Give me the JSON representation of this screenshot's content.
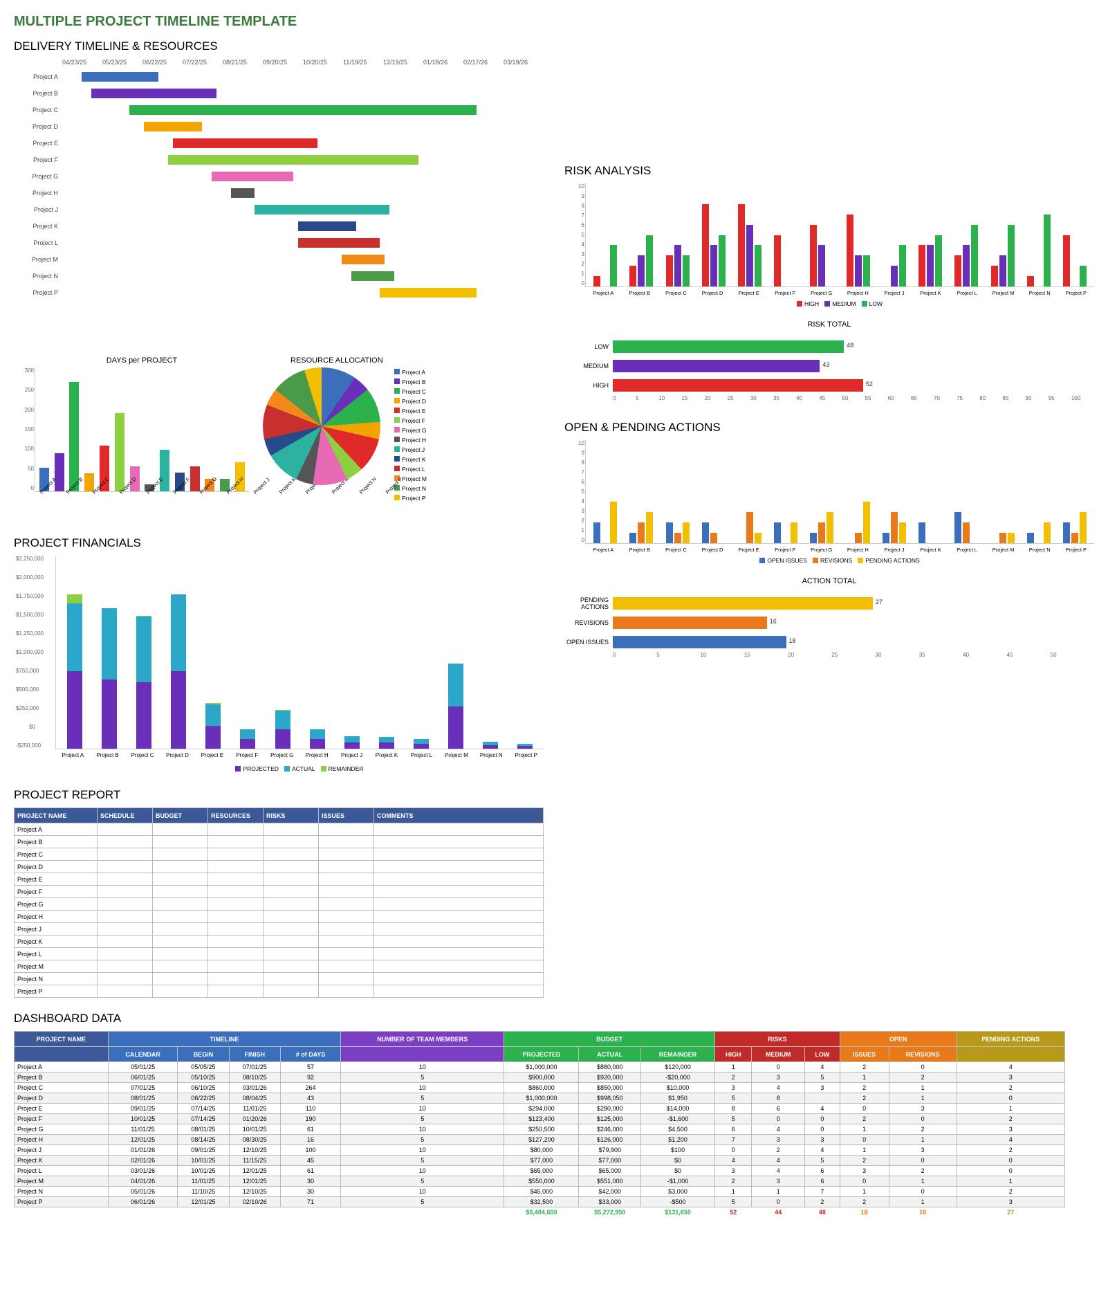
{
  "titles": {
    "main": "MULTIPLE PROJECT TIMELINE TEMPLATE",
    "delivery": "DELIVERY TIMELINE & RESOURCES",
    "risk": "RISK ANALYSIS",
    "risk_total": "RISK TOTAL",
    "actions": "OPEN & PENDING ACTIONS",
    "action_total": "ACTION TOTAL",
    "days_per_project": "DAYS per PROJECT",
    "resource_alloc": "RESOURCE ALLOCATION",
    "financials": "PROJECT FINANCIALS",
    "report": "PROJECT REPORT",
    "dashboard": "DASHBOARD DATA"
  },
  "projects": [
    "Project A",
    "Project B",
    "Project C",
    "Project D",
    "Project E",
    "Project F",
    "Project G",
    "Project H",
    "Project J",
    "Project K",
    "Project L",
    "Project M",
    "Project N",
    "Project P"
  ],
  "colors": {
    "Project A": "#3b6fbb",
    "Project B": "#6a2fb8",
    "Project C": "#2bb24c",
    "Project D": "#f2a500",
    "Project E": "#e02a2a",
    "Project F": "#8ecf42",
    "Project G": "#e86ab5",
    "Project H": "#555555",
    "Project J": "#2bb2a0",
    "Project K": "#284a8a",
    "Project L": "#c83030",
    "Project M": "#f28a1a",
    "Project N": "#4a9a4a",
    "Project P": "#f2c000"
  },
  "risk_colors": {
    "HIGH": "#e02a2a",
    "MEDIUM": "#6a2fb8",
    "LOW": "#2bb24c"
  },
  "action_colors": {
    "OPEN ISSUES": "#3b6fbb",
    "REVISIONS": "#e87a1a",
    "PENDING ACTIONS": "#f2c000"
  },
  "chart_data": [
    {
      "type": "gantt",
      "title": "DELIVERY TIMELINE & RESOURCES",
      "x_ticks": [
        "04/23/25",
        "05/23/25",
        "06/22/25",
        "07/22/25",
        "08/21/25",
        "09/20/25",
        "10/20/25",
        "11/19/25",
        "12/19/25",
        "01/18/26",
        "02/17/26",
        "03/19/26"
      ],
      "bars": [
        {
          "name": "Project A",
          "start_pct": 4,
          "width_pct": 16
        },
        {
          "name": "Project B",
          "start_pct": 6,
          "width_pct": 26
        },
        {
          "name": "Project C",
          "start_pct": 14,
          "width_pct": 72
        },
        {
          "name": "Project D",
          "start_pct": 17,
          "width_pct": 12
        },
        {
          "name": "Project E",
          "start_pct": 23,
          "width_pct": 30
        },
        {
          "name": "Project F",
          "start_pct": 22,
          "width_pct": 52
        },
        {
          "name": "Project G",
          "start_pct": 31,
          "width_pct": 17
        },
        {
          "name": "Project H",
          "start_pct": 35,
          "width_pct": 5
        },
        {
          "name": "Project J",
          "start_pct": 40,
          "width_pct": 28
        },
        {
          "name": "Project K",
          "start_pct": 49,
          "width_pct": 12
        },
        {
          "name": "Project L",
          "start_pct": 49,
          "width_pct": 17
        },
        {
          "name": "Project M",
          "start_pct": 58,
          "width_pct": 9
        },
        {
          "name": "Project N",
          "start_pct": 60,
          "width_pct": 9
        },
        {
          "name": "Project P",
          "start_pct": 66,
          "width_pct": 20
        }
      ]
    },
    {
      "type": "bar",
      "title": "DAYS per PROJECT",
      "categories": [
        "Project A",
        "Project B",
        "Project C",
        "Project D",
        "Project E",
        "Project F",
        "Project G",
        "Project H",
        "Project J",
        "Project K",
        "Project L",
        "Project M",
        "Project N",
        "Project P"
      ],
      "values": [
        57,
        92,
        264,
        43,
        110,
        190,
        61,
        16,
        100,
        45,
        61,
        30,
        30,
        71
      ],
      "ylim": [
        0,
        300
      ],
      "yticks": [
        0,
        50,
        100,
        150,
        200,
        250,
        300
      ]
    },
    {
      "type": "pie",
      "title": "RESOURCE ALLOCATION",
      "labels": [
        "Project A",
        "Project B",
        "Project C",
        "Project D",
        "Project E",
        "Project F",
        "Project G",
        "Project H",
        "Project J",
        "Project K",
        "Project L",
        "Project M",
        "Project N",
        "Project P"
      ],
      "values": [
        10,
        5,
        10,
        5,
        10,
        5,
        10,
        5,
        10,
        5,
        10,
        5,
        10,
        5
      ]
    },
    {
      "type": "bar",
      "title": "PROJECT FINANCIALS",
      "stacked": true,
      "categories": [
        "Project A",
        "Project B",
        "Project C",
        "Project D",
        "Project E",
        "Project F",
        "Project G",
        "Project H",
        "Project J",
        "Project K",
        "Project L",
        "Project M",
        "Project N",
        "Project P"
      ],
      "series": [
        {
          "name": "PROJECTED",
          "color": "#6a2fb8",
          "values": [
            1000000,
            900000,
            860000,
            1000000,
            294000,
            123400,
            250500,
            127200,
            80000,
            77000,
            65000,
            550000,
            45000,
            32500
          ]
        },
        {
          "name": "ACTUAL",
          "color": "#2ba8c9",
          "values": [
            880000,
            920000,
            850000,
            998050,
            280000,
            125000,
            246000,
            126000,
            79900,
            77000,
            65000,
            551000,
            42000,
            33000
          ]
        },
        {
          "name": "REMAINDER",
          "color": "#8ecf42",
          "values": [
            120000,
            -20000,
            10000,
            1950,
            14000,
            -1600,
            4500,
            1200,
            100,
            0,
            0,
            -1000,
            3000,
            -500
          ]
        }
      ],
      "ylim": [
        -250000,
        2250000
      ],
      "yticks": [
        "-$250,000",
        "$0",
        "$250,000",
        "$500,000",
        "$750,000",
        "$1,000,000",
        "$1,250,000",
        "$1,500,000",
        "$1,750,000",
        "$2,000,000",
        "$2,250,000"
      ]
    },
    {
      "type": "bar",
      "title": "RISK ANALYSIS",
      "categories": [
        "Project A",
        "Project B",
        "Project C",
        "Project D",
        "Project E",
        "Project F",
        "Project G",
        "Project H",
        "Project J",
        "Project K",
        "Project L",
        "Project M",
        "Project N",
        "Project P"
      ],
      "series": [
        {
          "name": "HIGH",
          "color": "#e02a2a",
          "values": [
            1,
            2,
            3,
            8,
            8,
            5,
            6,
            7,
            0,
            4,
            3,
            2,
            1,
            5
          ]
        },
        {
          "name": "MEDIUM",
          "color": "#6a2fb8",
          "values": [
            0,
            3,
            4,
            4,
            6,
            0,
            4,
            3,
            2,
            4,
            4,
            3,
            0,
            0
          ]
        },
        {
          "name": "LOW",
          "color": "#2bb24c",
          "values": [
            4,
            5,
            3,
            5,
            4,
            0,
            0,
            3,
            4,
            5,
            6,
            6,
            7,
            2
          ]
        }
      ],
      "ylim": [
        0,
        10
      ],
      "yticks": [
        0,
        1,
        2,
        3,
        4,
        5,
        6,
        7,
        8,
        9,
        10
      ]
    },
    {
      "type": "hbar",
      "title": "RISK TOTAL",
      "categories": [
        "LOW",
        "MEDIUM",
        "HIGH"
      ],
      "values": [
        48,
        43,
        52
      ],
      "colors": [
        "#2bb24c",
        "#6a2fb8",
        "#e02a2a"
      ],
      "xlim": [
        0,
        100
      ],
      "xticks": [
        0,
        5,
        10,
        15,
        20,
        25,
        30,
        35,
        40,
        45,
        50,
        55,
        60,
        65,
        70,
        75,
        80,
        85,
        90,
        95,
        100
      ]
    },
    {
      "type": "bar",
      "title": "OPEN & PENDING ACTIONS",
      "categories": [
        "Project A",
        "Project B",
        "Project C",
        "Project D",
        "Project E",
        "Project F",
        "Project G",
        "Project H",
        "Project J",
        "Project K",
        "Project L",
        "Project M",
        "Project N",
        "Project P"
      ],
      "series": [
        {
          "name": "OPEN ISSUES",
          "color": "#3b6fbb",
          "values": [
            2,
            1,
            2,
            2,
            0,
            2,
            1,
            0,
            1,
            2,
            3,
            0,
            1,
            2
          ]
        },
        {
          "name": "REVISIONS",
          "color": "#e87a1a",
          "values": [
            0,
            2,
            1,
            1,
            3,
            0,
            2,
            1,
            3,
            0,
            2,
            1,
            0,
            1
          ]
        },
        {
          "name": "PENDING ACTIONS",
          "color": "#f2c000",
          "values": [
            4,
            3,
            2,
            0,
            1,
            2,
            3,
            4,
            2,
            0,
            0,
            1,
            2,
            3
          ]
        }
      ],
      "ylim": [
        0,
        10
      ],
      "yticks": [
        0,
        1,
        2,
        3,
        4,
        5,
        6,
        7,
        8,
        9,
        10
      ]
    },
    {
      "type": "hbar",
      "title": "ACTION TOTAL",
      "categories": [
        "PENDING ACTIONS",
        "REVISIONS",
        "OPEN ISSUES"
      ],
      "values": [
        27,
        16,
        18
      ],
      "colors": [
        "#f2c000",
        "#e87a1a",
        "#3b6fbb"
      ],
      "xlim": [
        0,
        50
      ],
      "xticks": [
        0,
        5,
        10,
        15,
        20,
        25,
        30,
        35,
        40,
        45,
        50
      ]
    }
  ],
  "report_table": {
    "headers": [
      "PROJECT NAME",
      "SCHEDULE",
      "BUDGET",
      "RESOURCES",
      "RISKS",
      "ISSUES",
      "COMMENTS"
    ],
    "rows": [
      "Project A",
      "Project B",
      "Project C",
      "Project D",
      "Project E",
      "Project F",
      "Project G",
      "Project H",
      "Project J",
      "Project K",
      "Project L",
      "Project M",
      "Project N",
      "Project P"
    ]
  },
  "dashboard": {
    "group_headers": [
      {
        "label": "PROJECT NAME",
        "span": 1,
        "bg": "#3b5998"
      },
      {
        "label": "TIMELINE",
        "span": 4,
        "bg": "#3b6fbb"
      },
      {
        "label": "NUMBER OF TEAM MEMBERS",
        "span": 1,
        "bg": "#7a3fc2"
      },
      {
        "label": "BUDGET",
        "span": 3,
        "bg": "#2bb24c"
      },
      {
        "label": "RISKS",
        "span": 3,
        "bg": "#c22a2a"
      },
      {
        "label": "OPEN",
        "span": 2,
        "bg": "#e87a1a"
      },
      {
        "label": "PENDING ACTIONS",
        "span": 1,
        "bg": "#b89a1a"
      }
    ],
    "sub_headers": [
      {
        "label": "",
        "bg": "#3b5998"
      },
      {
        "label": "CALENDAR",
        "bg": "#3b6fbb"
      },
      {
        "label": "BEGIN",
        "bg": "#3b6fbb"
      },
      {
        "label": "FINISH",
        "bg": "#3b6fbb"
      },
      {
        "label": "# of DAYS",
        "bg": "#3b6fbb"
      },
      {
        "label": "",
        "bg": "#7a3fc2"
      },
      {
        "label": "PROJECTED",
        "bg": "#2bb24c"
      },
      {
        "label": "ACTUAL",
        "bg": "#2bb24c"
      },
      {
        "label": "REMAINDER",
        "bg": "#2bb24c"
      },
      {
        "label": "HIGH",
        "bg": "#c22a2a"
      },
      {
        "label": "MEDIUM",
        "bg": "#c22a2a"
      },
      {
        "label": "LOW",
        "bg": "#c22a2a"
      },
      {
        "label": "ISSUES",
        "bg": "#e87a1a"
      },
      {
        "label": "REVISIONS",
        "bg": "#e87a1a"
      },
      {
        "label": "",
        "bg": "#b89a1a"
      }
    ],
    "rows": [
      [
        "Project A",
        "05/01/25",
        "05/05/25",
        "07/01/25",
        "57",
        "10",
        "$1,000,000",
        "$880,000",
        "$120,000",
        "1",
        "0",
        "4",
        "2",
        "0",
        "4"
      ],
      [
        "Project B",
        "06/01/25",
        "05/10/25",
        "08/10/25",
        "92",
        "5",
        "$900,000",
        "$920,000",
        "-$20,000",
        "2",
        "3",
        "5",
        "1",
        "2",
        "3"
      ],
      [
        "Project C",
        "07/01/25",
        "06/10/25",
        "03/01/26",
        "264",
        "10",
        "$860,000",
        "$850,000",
        "$10,000",
        "3",
        "4",
        "3",
        "2",
        "1",
        "2"
      ],
      [
        "Project D",
        "08/01/25",
        "06/22/25",
        "08/04/25",
        "43",
        "5",
        "$1,000,000",
        "$998,050",
        "$1,950",
        "5",
        "8",
        "",
        "2",
        "1",
        "0"
      ],
      [
        "Project E",
        "09/01/25",
        "07/14/25",
        "11/01/25",
        "110",
        "10",
        "$294,000",
        "$280,000",
        "$14,000",
        "8",
        "6",
        "4",
        "0",
        "3",
        "1"
      ],
      [
        "Project F",
        "10/01/25",
        "07/14/25",
        "01/20/26",
        "190",
        "5",
        "$123,400",
        "$125,000",
        "-$1,600",
        "5",
        "0",
        "0",
        "2",
        "0",
        "2"
      ],
      [
        "Project G",
        "11/01/25",
        "08/01/25",
        "10/01/25",
        "61",
        "10",
        "$250,500",
        "$246,000",
        "$4,500",
        "6",
        "4",
        "0",
        "1",
        "2",
        "3"
      ],
      [
        "Project H",
        "12/01/25",
        "08/14/25",
        "08/30/25",
        "16",
        "5",
        "$127,200",
        "$126,000",
        "$1,200",
        "7",
        "3",
        "3",
        "0",
        "1",
        "4"
      ],
      [
        "Project J",
        "01/01/26",
        "09/01/25",
        "12/10/25",
        "100",
        "10",
        "$80,000",
        "$79,900",
        "$100",
        "0",
        "2",
        "4",
        "1",
        "3",
        "2"
      ],
      [
        "Project K",
        "02/01/26",
        "10/01/25",
        "11/15/25",
        "45",
        "5",
        "$77,000",
        "$77,000",
        "$0",
        "4",
        "4",
        "5",
        "2",
        "0",
        "0"
      ],
      [
        "Project L",
        "03/01/26",
        "10/01/25",
        "12/01/25",
        "61",
        "10",
        "$65,000",
        "$65,000",
        "$0",
        "3",
        "4",
        "6",
        "3",
        "2",
        "0"
      ],
      [
        "Project M",
        "04/01/26",
        "11/01/25",
        "12/01/25",
        "30",
        "5",
        "$550,000",
        "$551,000",
        "-$1,000",
        "2",
        "3",
        "6",
        "0",
        "1",
        "1"
      ],
      [
        "Project N",
        "05/01/26",
        "11/10/25",
        "12/10/25",
        "30",
        "10",
        "$45,000",
        "$42,000",
        "$3,000",
        "1",
        "1",
        "7",
        "1",
        "0",
        "2"
      ],
      [
        "Project P",
        "06/01/26",
        "12/01/25",
        "02/10/26",
        "71",
        "5",
        "$32,500",
        "$33,000",
        "-$500",
        "5",
        "0",
        "2",
        "2",
        "1",
        "3"
      ]
    ],
    "totals": [
      "",
      "",
      "",
      "",
      "",
      "",
      "$5,404,600",
      "$5,272,950",
      "$131,650",
      "52",
      "44",
      "48",
      "18",
      "16",
      "27"
    ],
    "total_colors": [
      "",
      "",
      "",
      "",
      "",
      "",
      "#2bb24c",
      "#2bb24c",
      "#2bb24c",
      "#c22a2a",
      "#c22a2a",
      "#c22a2a",
      "#e87a1a",
      "#e87a1a",
      "#b89a1a"
    ]
  }
}
